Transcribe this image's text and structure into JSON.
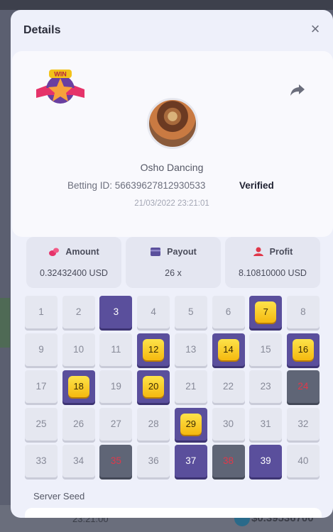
{
  "background": {
    "bottom_time": "23:21:00",
    "bottom_amount": "$0.39536700"
  },
  "modal": {
    "title": "Details",
    "close_label": "×"
  },
  "player": {
    "name": "Osho Dancing",
    "betting_id": "Betting ID: 56639627812930533",
    "verified_label": "Verified",
    "datetime": "21/03/2022 23:21:01",
    "badge_text": "WIN"
  },
  "stats": {
    "amount": {
      "label": "Amount",
      "value": "0.32432400 USD"
    },
    "payout": {
      "label": "Payout",
      "value": "26 x"
    },
    "profit": {
      "label": "Profit",
      "value": "8.10810000 USD"
    }
  },
  "board": {
    "cells": [
      {
        "n": "1",
        "state": "idle"
      },
      {
        "n": "2",
        "state": "idle"
      },
      {
        "n": "3",
        "state": "picked"
      },
      {
        "n": "4",
        "state": "idle"
      },
      {
        "n": "5",
        "state": "idle"
      },
      {
        "n": "6",
        "state": "idle"
      },
      {
        "n": "7",
        "state": "hit"
      },
      {
        "n": "8",
        "state": "idle"
      },
      {
        "n": "9",
        "state": "idle"
      },
      {
        "n": "10",
        "state": "idle"
      },
      {
        "n": "11",
        "state": "idle"
      },
      {
        "n": "12",
        "state": "hit"
      },
      {
        "n": "13",
        "state": "idle"
      },
      {
        "n": "14",
        "state": "hit"
      },
      {
        "n": "15",
        "state": "idle"
      },
      {
        "n": "16",
        "state": "hit"
      },
      {
        "n": "17",
        "state": "idle"
      },
      {
        "n": "18",
        "state": "hit"
      },
      {
        "n": "19",
        "state": "idle"
      },
      {
        "n": "20",
        "state": "hit"
      },
      {
        "n": "21",
        "state": "idle"
      },
      {
        "n": "22",
        "state": "idle"
      },
      {
        "n": "23",
        "state": "idle"
      },
      {
        "n": "24",
        "state": "miss"
      },
      {
        "n": "25",
        "state": "idle"
      },
      {
        "n": "26",
        "state": "idle"
      },
      {
        "n": "27",
        "state": "idle"
      },
      {
        "n": "28",
        "state": "idle"
      },
      {
        "n": "29",
        "state": "hit"
      },
      {
        "n": "30",
        "state": "idle"
      },
      {
        "n": "31",
        "state": "idle"
      },
      {
        "n": "32",
        "state": "idle"
      },
      {
        "n": "33",
        "state": "idle"
      },
      {
        "n": "34",
        "state": "idle"
      },
      {
        "n": "35",
        "state": "miss"
      },
      {
        "n": "36",
        "state": "idle"
      },
      {
        "n": "37",
        "state": "picked"
      },
      {
        "n": "38",
        "state": "miss"
      },
      {
        "n": "39",
        "state": "picked"
      },
      {
        "n": "40",
        "state": "idle"
      }
    ]
  },
  "server_seed": {
    "label": "Server Seed"
  },
  "colors": {
    "accent": "#5a4f9c",
    "gem": "#f5b90f",
    "miss_text": "#e0384a",
    "amount_icon": "#e5336a",
    "payout_icon": "#5a4f9c",
    "profit_icon": "#e0384a"
  },
  "icons": {
    "badge": "win-badge-icon",
    "share": "share-icon",
    "close": "close-icon",
    "amount": "coins-icon",
    "payout": "wallet-icon",
    "profit": "profit-icon"
  }
}
